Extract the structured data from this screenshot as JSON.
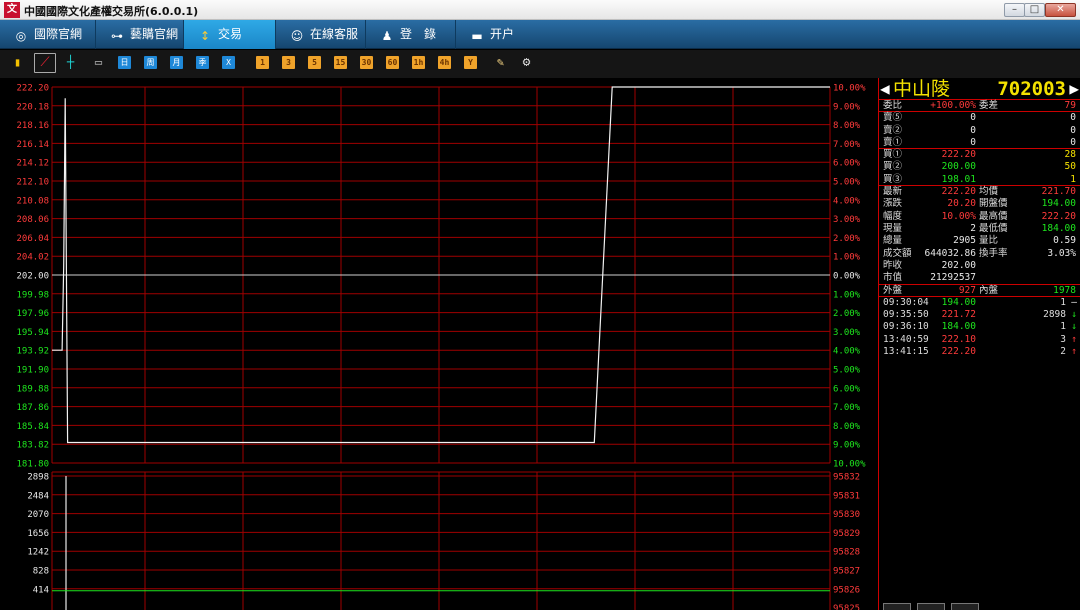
{
  "window": {
    "title": "中國國際文化產權交易所(6.0.0.1)",
    "logo_text": "文",
    "controls": {
      "minimize": "–",
      "maximize": "□",
      "close": "✕"
    }
  },
  "nav": {
    "items": [
      {
        "label": "國際官網",
        "icon": "globe-icon"
      },
      {
        "label": "藝購官網",
        "icon": "link-icon"
      },
      {
        "label": "交易",
        "icon": "exchange-icon",
        "active": true
      },
      {
        "label": "在線客服",
        "icon": "chat-icon"
      },
      {
        "label": "登　錄",
        "icon": "user-icon"
      },
      {
        "label": "开户",
        "icon": "card-icon"
      }
    ]
  },
  "toolbar": {
    "period_buttons": [
      "日",
      "周",
      "月",
      "季",
      "X"
    ],
    "minute_buttons": [
      "1",
      "3",
      "5",
      "15",
      "30",
      "60",
      "1h",
      "4h",
      "Y"
    ],
    "colors": {
      "blue": "#1e88d8",
      "orange": "#f0a32a"
    }
  },
  "chart_data": {
    "type": "line",
    "price_axis": {
      "ticks": [
        "222.20",
        "220.18",
        "218.16",
        "216.14",
        "214.12",
        "212.10",
        "210.08",
        "208.06",
        "206.04",
        "204.02",
        "202.00",
        "199.98",
        "197.96",
        "195.94",
        "193.92",
        "191.90",
        "189.88",
        "187.86",
        "185.84",
        "183.82",
        "181.80"
      ],
      "ylim": [
        181.8,
        222.2
      ],
      "base": 202.0
    },
    "percent_axis": {
      "ticks": [
        "10.00%",
        "9.00%",
        "8.00%",
        "7.00%",
        "6.00%",
        "5.00%",
        "4.00%",
        "3.00%",
        "2.00%",
        "1.00%",
        "0.00%",
        "1.00%",
        "2.00%",
        "3.00%",
        "4.00%",
        "5.00%",
        "6.00%",
        "7.00%",
        "8.00%",
        "9.00%",
        "10.00%"
      ]
    },
    "price_line": {
      "x": [
        0,
        0.013,
        0.015,
        0.017,
        0.02,
        0.033,
        0.667,
        0.697,
        0.72,
        1.0
      ],
      "y": [
        193.92,
        193.92,
        203.0,
        221.0,
        184.0,
        184.0,
        184.0,
        184.0,
        222.2,
        222.2
      ]
    },
    "volume_axis": {
      "ticks": [
        "2898",
        "2484",
        "2070",
        "1656",
        "1242",
        "828",
        "414"
      ],
      "ylim": [
        0,
        2898
      ]
    },
    "oi_axis": {
      "ticks": [
        "95832",
        "95831",
        "95830",
        "95829",
        "95828",
        "95827",
        "95826",
        "95825"
      ]
    },
    "volume_bar": {
      "x": 0.018,
      "value": 2898
    },
    "oi_level": 95826,
    "colors": {
      "grid": "#a00000",
      "up": "#ff3b3b",
      "down": "#1ee61e",
      "flat": "#e8e8e8",
      "line": "#f2f2f2"
    }
  },
  "panel": {
    "stock_name": "中山陵",
    "stock_code": "702003",
    "order_ratio": {
      "label": "委比",
      "value": "+100.00%",
      "label2": "委差",
      "value2": "79"
    },
    "sell": [
      {
        "label": "賣⑤",
        "price": "0",
        "vol": "0"
      },
      {
        "label": "賣②",
        "price": "0",
        "vol": "0"
      },
      {
        "label": "賣①",
        "price": "0",
        "vol": "0"
      }
    ],
    "buy": [
      {
        "label": "買①",
        "price": "222.20",
        "vol": "28",
        "color": "red"
      },
      {
        "label": "買②",
        "price": "200.00",
        "vol": "50",
        "color": "green"
      },
      {
        "label": "買③",
        "price": "198.01",
        "vol": "1",
        "color": "green"
      }
    ],
    "stats": [
      {
        "l1": "最新",
        "v1": "222.20",
        "c1": "red",
        "l2": "均價",
        "v2": "221.70",
        "c2": "red"
      },
      {
        "l1": "漲跌",
        "v1": "20.20",
        "c1": "red",
        "l2": "開盤價",
        "v2": "194.00",
        "c2": "green"
      },
      {
        "l1": "幅度",
        "v1": "10.00%",
        "c1": "red",
        "l2": "最高價",
        "v2": "222.20",
        "c2": "red"
      },
      {
        "l1": "現量",
        "v1": "2",
        "c1": "white",
        "l2": "最低價",
        "v2": "184.00",
        "c2": "green"
      },
      {
        "l1": "總量",
        "v1": "2905",
        "c1": "white",
        "l2": "量比",
        "v2": "0.59",
        "c2": "white"
      },
      {
        "l1": "成交額",
        "v1": "644032.86",
        "c1": "white",
        "l2": "換手率",
        "v2": "3.03%",
        "c2": "white"
      },
      {
        "l1": "昨收",
        "v1": "202.00",
        "c1": "white",
        "l2": "",
        "v2": "",
        "c2": "white"
      },
      {
        "l1": "市值",
        "v1": "21292537",
        "c1": "white",
        "l2": "",
        "v2": "",
        "c2": "white"
      }
    ],
    "outer_inner": {
      "l1": "外盤",
      "v1": "927",
      "l2": "內盤",
      "v2": "1978"
    },
    "ticks": [
      {
        "time": "09:30:04",
        "price": "194.00",
        "vol": "1",
        "arrow": "–",
        "color": "green",
        "acolor": "white"
      },
      {
        "time": "09:35:50",
        "price": "221.72",
        "vol": "2898",
        "arrow": "↓",
        "color": "red",
        "acolor": "green"
      },
      {
        "time": "09:36:10",
        "price": "184.00",
        "vol": "1",
        "arrow": "↓",
        "color": "green",
        "acolor": "green"
      },
      {
        "time": "13:40:59",
        "price": "222.10",
        "vol": "3",
        "arrow": "↑",
        "color": "red",
        "acolor": "red"
      },
      {
        "time": "13:41:15",
        "price": "222.20",
        "vol": "2",
        "arrow": "↑",
        "color": "red",
        "acolor": "red"
      }
    ]
  }
}
